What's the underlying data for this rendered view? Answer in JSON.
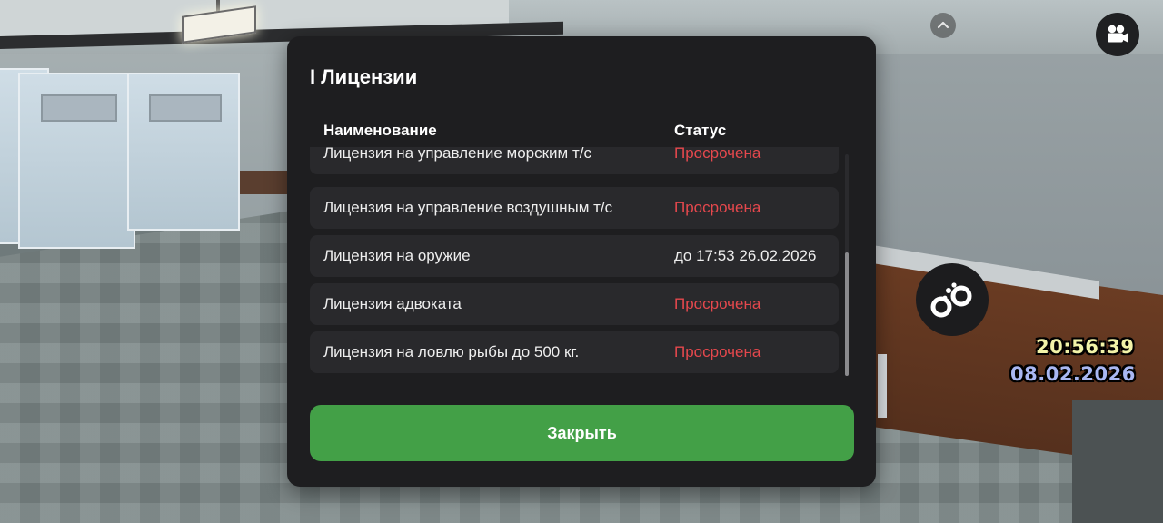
{
  "dialog": {
    "title": "I Лицензии",
    "columns": {
      "name": "Наименование",
      "status": "Статус"
    },
    "rows": [
      {
        "name": "Лицензия на управление морским т/с",
        "status": "Просрочена",
        "status_color": "#e5484d"
      },
      {
        "name": "Лицензия на управление воздушным т/с",
        "status": "Просрочена",
        "status_color": "#e5484d"
      },
      {
        "name": "Лицензия на оружие",
        "status": "до 17:53 26.02.2026",
        "status_color": "#eeeeee"
      },
      {
        "name": "Лицензия адвоката",
        "status": "Просрочена",
        "status_color": "#e5484d"
      },
      {
        "name": "Лицензия на ловлю рыбы до 500 кг.",
        "status": "Просрочена",
        "status_color": "#e5484d"
      }
    ],
    "close_label": "Закрыть",
    "accent_color": "#43a047"
  },
  "hud": {
    "time": "20:56:39",
    "date": "08.02.2026",
    "icons": [
      "chevron-up-icon",
      "video-camera-icon",
      "handcuffs-icon"
    ]
  }
}
